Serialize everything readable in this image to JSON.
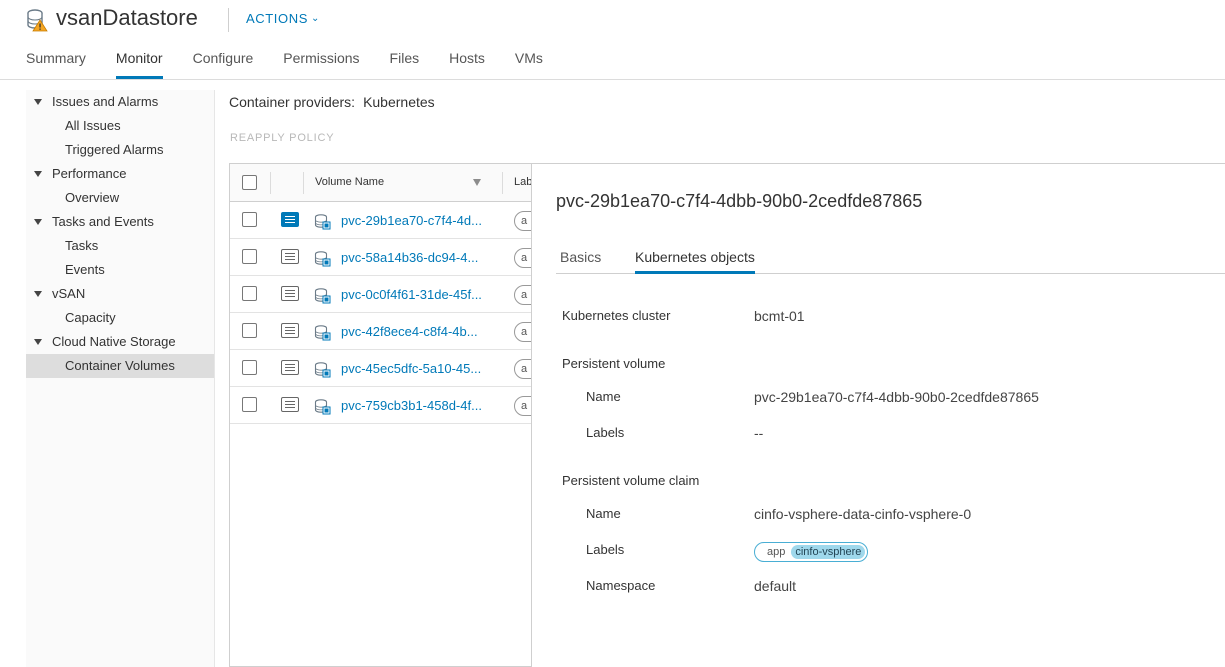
{
  "header": {
    "title": "vsanDatastore",
    "actions_label": "ACTIONS",
    "tabs": [
      {
        "label": "Summary",
        "active": false
      },
      {
        "label": "Monitor",
        "active": true
      },
      {
        "label": "Configure",
        "active": false
      },
      {
        "label": "Permissions",
        "active": false
      },
      {
        "label": "Files",
        "active": false
      },
      {
        "label": "Hosts",
        "active": false
      },
      {
        "label": "VMs",
        "active": false
      }
    ]
  },
  "sidebar": {
    "items": [
      {
        "label": "Issues and Alarms",
        "type": "group"
      },
      {
        "label": "All Issues",
        "type": "child"
      },
      {
        "label": "Triggered Alarms",
        "type": "child"
      },
      {
        "label": "Performance",
        "type": "group"
      },
      {
        "label": "Overview",
        "type": "child"
      },
      {
        "label": "Tasks and Events",
        "type": "group"
      },
      {
        "label": "Tasks",
        "type": "child"
      },
      {
        "label": "Events",
        "type": "child"
      },
      {
        "label": "vSAN",
        "type": "group"
      },
      {
        "label": "Capacity",
        "type": "child"
      },
      {
        "label": "Cloud Native Storage",
        "type": "group"
      },
      {
        "label": "Container Volumes",
        "type": "child",
        "selected": true
      }
    ]
  },
  "main": {
    "providers_label": "Container providers:",
    "providers_value": "Kubernetes",
    "reapply_label": "REAPPLY POLICY",
    "grid": {
      "columns": [
        "Volume Name",
        "Lab"
      ],
      "rows": [
        {
          "name": "pvc-29b1ea70-c7f4-4d...",
          "label": "a",
          "active": true
        },
        {
          "name": "pvc-58a14b36-dc94-4...",
          "label": "a",
          "active": false
        },
        {
          "name": "pvc-0c0f4f61-31de-45f...",
          "label": "a",
          "active": false
        },
        {
          "name": "pvc-42f8ece4-c8f4-4b...",
          "label": "a",
          "active": false
        },
        {
          "name": "pvc-45ec5dfc-5a10-45...",
          "label": "a",
          "active": false
        },
        {
          "name": "pvc-759cb3b1-458d-4f...",
          "label": "a",
          "active": false
        }
      ]
    }
  },
  "detail": {
    "title": "pvc-29b1ea70-c7f4-4dbb-90b0-2cedfde87865",
    "tabs": [
      {
        "label": "Basics",
        "active": false
      },
      {
        "label": "Kubernetes objects",
        "active": true
      }
    ],
    "cluster_label": "Kubernetes cluster",
    "cluster_value": "bcmt-01",
    "pv_section": "Persistent volume",
    "pv_name_label": "Name",
    "pv_name_value": "pvc-29b1ea70-c7f4-4dbb-90b0-2cedfde87865",
    "pv_labels_label": "Labels",
    "pv_labels_value": "--",
    "pvc_section": "Persistent volume claim",
    "pvc_name_label": "Name",
    "pvc_name_value": "cinfo-vsphere-data-cinfo-vsphere-0",
    "pvc_labels_label": "Labels",
    "pvc_tag_key": "app",
    "pvc_tag_value": "cinfo-vsphere",
    "namespace_label": "Namespace",
    "namespace_value": "default"
  },
  "colors": {
    "accent": "#0079b8",
    "tag_border": "#49aed4",
    "tag_fill": "#9fd8ec",
    "warning": "#f5a623"
  },
  "icons": [
    "datastore-warning-icon",
    "chevron-down-icon",
    "filter-icon",
    "row-detail-icon",
    "volume-icon",
    "caret-down-icon"
  ]
}
